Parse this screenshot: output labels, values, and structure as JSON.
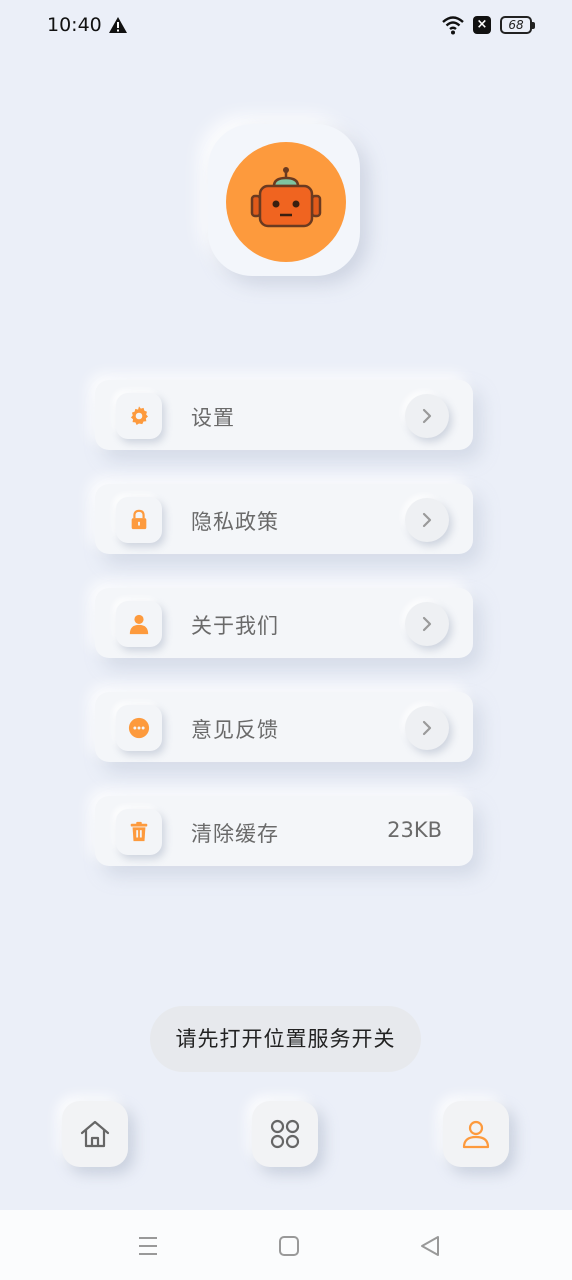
{
  "status_bar": {
    "time": "10:40",
    "battery": "68",
    "icons": [
      "warning-icon",
      "wifi-icon",
      "notification-x-icon",
      "battery-icon"
    ]
  },
  "avatar": {
    "icon": "robot-icon",
    "color": "#fd9a3d"
  },
  "menu": {
    "items": [
      {
        "label": "设置",
        "icon": "gear-icon"
      },
      {
        "label": "隐私政策",
        "icon": "lock-icon"
      },
      {
        "label": "关于我们",
        "icon": "person-icon"
      },
      {
        "label": "意见反馈",
        "icon": "chat-bubble-icon"
      },
      {
        "label": "清除缓存",
        "icon": "trash-icon",
        "value": "23KB"
      }
    ]
  },
  "toast": {
    "text": "请先打开位置服务开关"
  },
  "tab_bar": {
    "tabs": [
      {
        "icon": "home-icon",
        "active": false
      },
      {
        "icon": "grid-icon",
        "active": false
      },
      {
        "icon": "user-icon",
        "active": true
      }
    ]
  },
  "nav_bar": {
    "icons": [
      "menu-icon",
      "square-icon",
      "back-triangle-icon"
    ]
  },
  "colors": {
    "accent": "#fd9a3d",
    "background": "#ebeff8"
  }
}
